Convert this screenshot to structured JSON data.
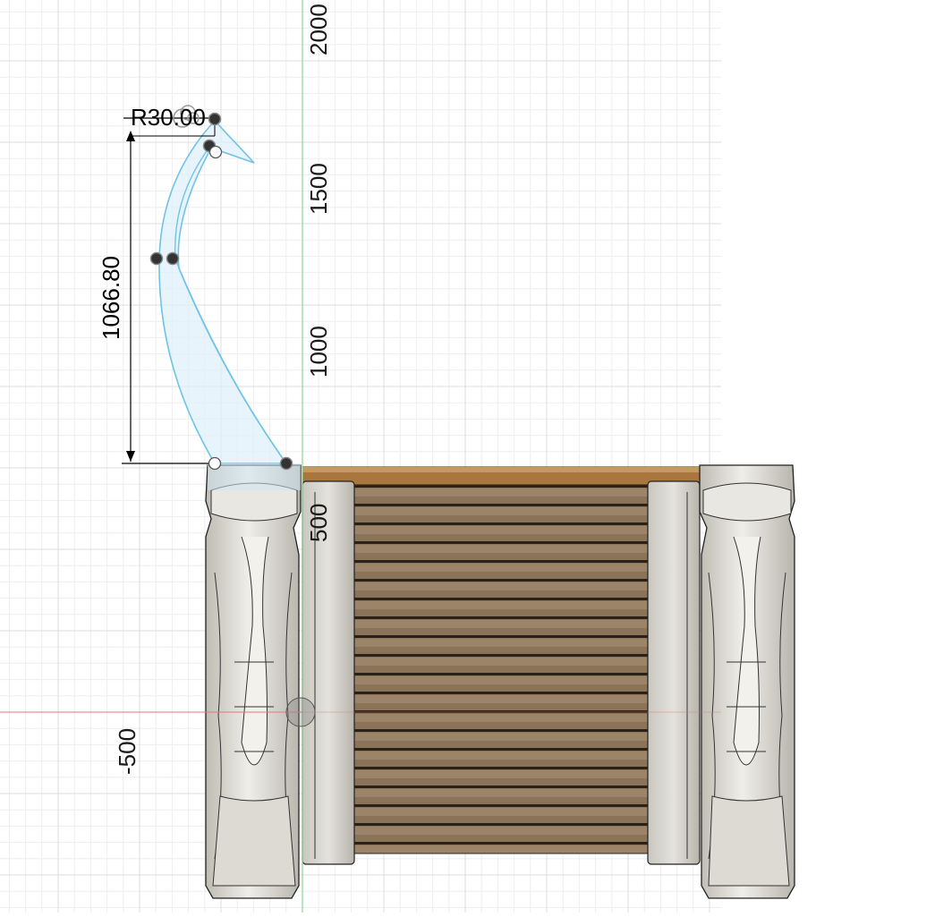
{
  "canvas": {
    "background": "#ffffff",
    "grid_minor_color": "#eeeeee",
    "grid_major_color": "#dcdcdc",
    "y_axis_color": "#8fd48f",
    "x_axis_color": "#e07878"
  },
  "axis_labels": {
    "y_2000": "2000",
    "y_1500": "1500",
    "y_1000": "1000",
    "y_500": "500",
    "x_neg500": "-500"
  },
  "sketch": {
    "dimension_vertical": "1066.80",
    "dimension_radius": "R30.00",
    "profile_stroke": "#6fc3e6",
    "profile_fill": "#dff0fa"
  },
  "model": {
    "wood_color": "#8a7359",
    "top_board_color": "#a9773e",
    "stone_color": "#d6d4cd"
  }
}
